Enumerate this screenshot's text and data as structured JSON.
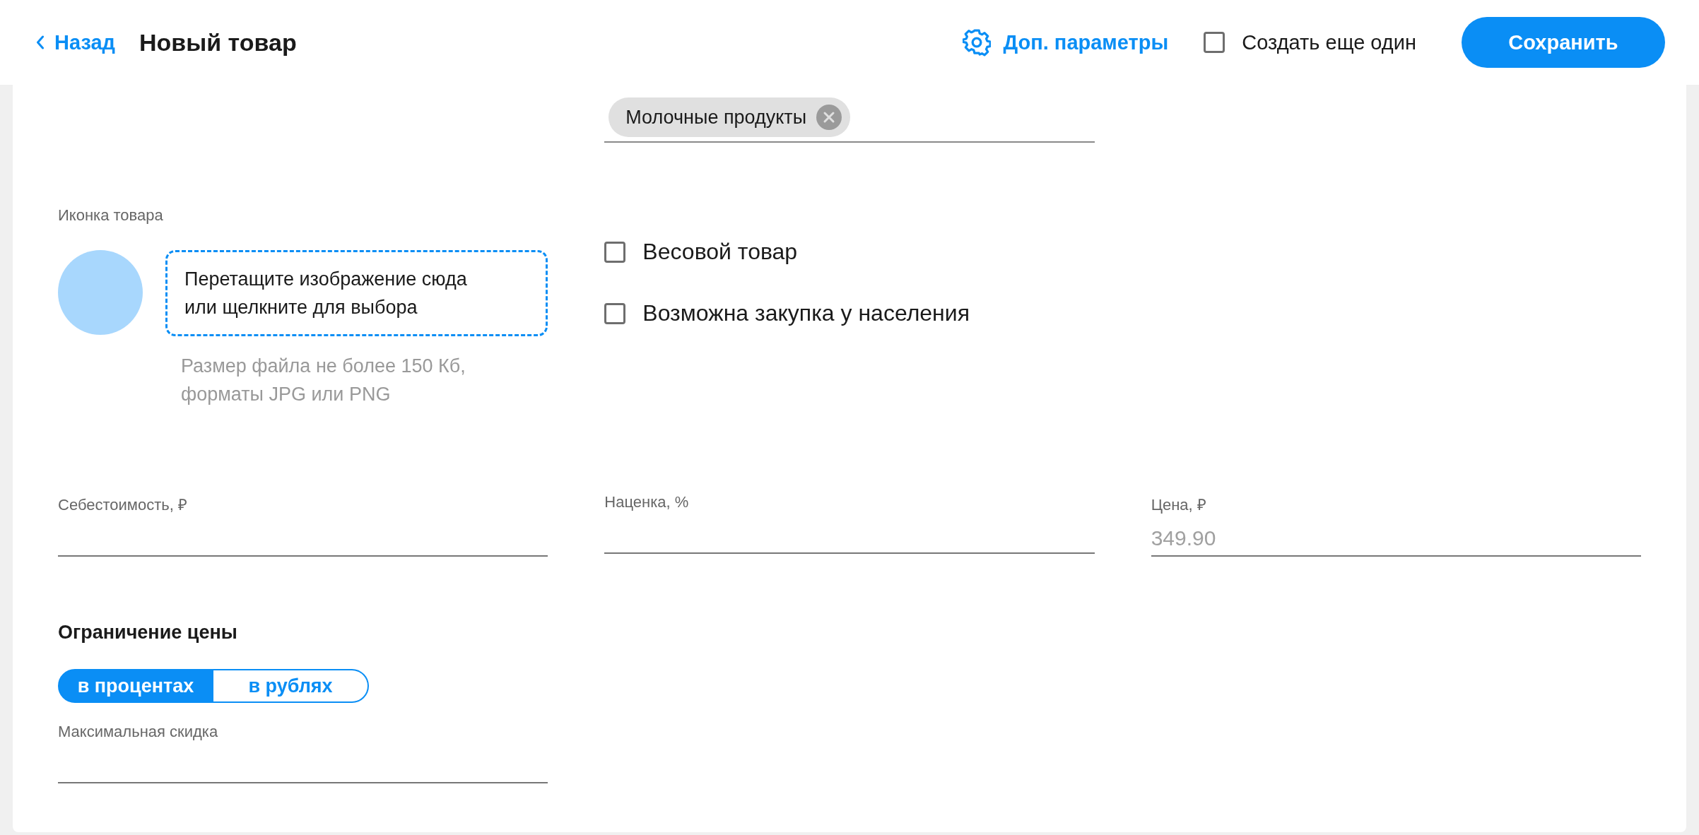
{
  "header": {
    "back": "Назад",
    "title": "Новый товар",
    "extra_params": "Доп. параметры",
    "create_another": {
      "label": "Создать еще один",
      "checked": false
    },
    "save": "Сохранить"
  },
  "categories": {
    "chips": [
      {
        "label": "Молочные продукты"
      }
    ]
  },
  "product_icon": {
    "label": "Иконка товара",
    "dropzone": "Перетащите изображение сюда\nили щелкните для выбора",
    "hint": "Размер файла не более 150 Кб,\nформаты JPG или PNG"
  },
  "options": [
    {
      "label": "Весовой товар",
      "checked": false
    },
    {
      "label": "Возможна закупка у населения",
      "checked": false
    }
  ],
  "price_fields": [
    {
      "label": "Себестоимость, ₽"
    },
    {
      "label": "Наценка, %"
    },
    {
      "label": "Цена, ₽",
      "placeholder": "349.90"
    }
  ],
  "price_limit": {
    "title": "Ограничение цены",
    "modes": [
      {
        "label": "в процентах",
        "selected": true
      },
      {
        "label": "в рублях",
        "selected": false
      }
    ],
    "field": {
      "label": "Максимальная скидка"
    }
  }
}
